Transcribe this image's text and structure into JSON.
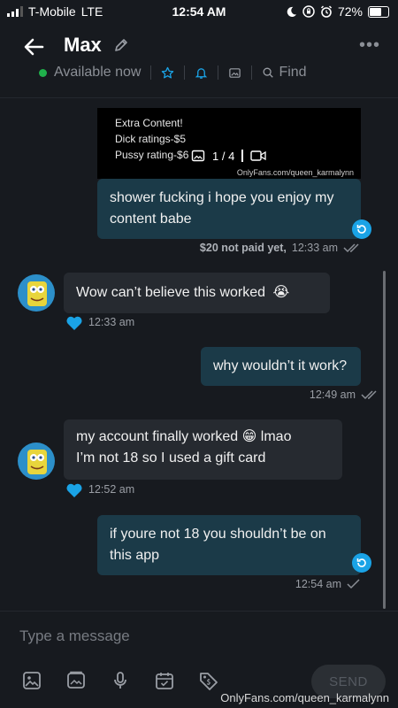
{
  "status": {
    "carrier": "T-Mobile",
    "network": "LTE",
    "time": "12:54 AM",
    "battery": "72%",
    "battery_level": 0.72
  },
  "header": {
    "title": "Max",
    "availability": "Available now",
    "find_label": "Find"
  },
  "media": {
    "lines": [
      "Extra Content!",
      "Dick ratings-$5",
      "Pussy rating-$6"
    ],
    "counter": "1 / 4",
    "credit": "OnlyFans.com/queen_karmalynn"
  },
  "messages": [
    {
      "text": "shower fucking i hope you enjoy my content babe",
      "price": "$20 not paid yet,",
      "time": "12:33 am"
    },
    {
      "text": "Wow can’t believe this worked",
      "emoji": "😭",
      "time": "12:33 am"
    },
    {
      "text": "why wouldn’t it work?",
      "time": "12:49 am"
    },
    {
      "text_a": "my account finally worked",
      "emoji": "😁",
      "text_b": "lmao",
      "text_c": "I’m not 18 so I used a gift card",
      "time": "12:52 am"
    },
    {
      "text": "if youre not 18 you shouldn’t be on this app",
      "time": "12:54 am"
    }
  ],
  "composer": {
    "placeholder": "Type a message",
    "send_label": "SEND"
  },
  "watermark": "OnlyFans.com/queen_karmalynn",
  "colors": {
    "background": "#171a1f",
    "outgoing_bubble": "#1b3a48",
    "incoming_bubble": "#262a30",
    "accent": "#1aa3e6",
    "online": "#20b04b"
  }
}
